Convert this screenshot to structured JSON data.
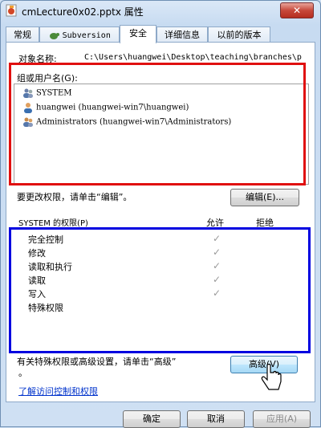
{
  "window": {
    "title": "cmLecture0x02.pptx 属性",
    "close_label": "✕"
  },
  "tabs": [
    {
      "label": "常规"
    },
    {
      "label": "Subversion"
    },
    {
      "label": "安全"
    },
    {
      "label": "详细信息"
    },
    {
      "label": "以前的版本"
    }
  ],
  "security": {
    "object_label": "对象名称:",
    "object_path": "C:\\Users\\huangwei\\Desktop\\teaching\\branches\\p",
    "groups_label": "组或用户名(G):",
    "users": [
      {
        "name": "SYSTEM",
        "icon": "group-icon"
      },
      {
        "name": "huangwei (huangwei-win7\\huangwei)",
        "icon": "user-icon"
      },
      {
        "name": "Administrators (huangwei-win7\\Administrators)",
        "icon": "group-icon"
      }
    ],
    "change_hint": "要更改权限，请单击“编辑”。",
    "edit_button": "编辑(E)...",
    "perm_header": "SYSTEM 的权限(P)",
    "allow_header": "允许",
    "deny_header": "拒绝",
    "permissions": [
      {
        "name": "完全控制",
        "allow": true
      },
      {
        "name": "修改",
        "allow": true
      },
      {
        "name": "读取和执行",
        "allow": true
      },
      {
        "name": "读取",
        "allow": true
      },
      {
        "name": "写入",
        "allow": true
      },
      {
        "name": "特殊权限",
        "allow": false
      }
    ],
    "advanced_hint_1": "有关特殊权限或高级设置，请单击“高级”",
    "advanced_hint_2": "。",
    "advanced_button": "高级(V)",
    "learn_link": "了解访问控制和权限"
  },
  "footer": {
    "ok": "确定",
    "cancel": "取消",
    "apply": "应用(A)"
  },
  "colors": {
    "highlight_red": "#e01010",
    "highlight_blue": "#0000e0",
    "link": "#0033cc"
  }
}
